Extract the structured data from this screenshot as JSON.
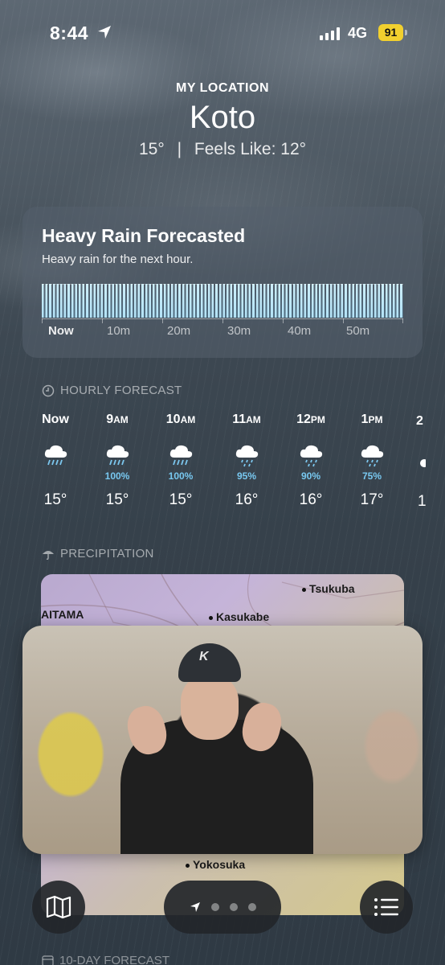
{
  "status_bar": {
    "time": "8:44",
    "network": "4G",
    "battery": "91",
    "battery_color": "#f2d02e"
  },
  "header": {
    "location_label": "MY LOCATION",
    "city": "Koto",
    "current_temp": "15°",
    "separator": "|",
    "feels_like": "Feels Like: 12°"
  },
  "rain_alert": {
    "title": "Heavy Rain Forecasted",
    "subtitle": "Heavy rain for the next hour.",
    "axis_labels": [
      "Now",
      "10m",
      "20m",
      "30m",
      "40m",
      "50m"
    ],
    "bar_color": "#cdeefa"
  },
  "hourly": {
    "header": "HOURLY FORECAST",
    "icon": "clock-icon",
    "items": [
      {
        "hour": "Now",
        "ampm": "",
        "icon": "rain-cloud-icon",
        "chance": "",
        "temp": "15°"
      },
      {
        "hour": "9",
        "ampm": "AM",
        "icon": "rain-cloud-icon",
        "chance": "100%",
        "temp": "15°"
      },
      {
        "hour": "10",
        "ampm": "AM",
        "icon": "rain-cloud-icon",
        "chance": "100%",
        "temp": "15°"
      },
      {
        "hour": "11",
        "ampm": "AM",
        "icon": "drizzle-cloud-icon",
        "chance": "95%",
        "temp": "16°"
      },
      {
        "hour": "12",
        "ampm": "PM",
        "icon": "drizzle-cloud-icon",
        "chance": "90%",
        "temp": "16°"
      },
      {
        "hour": "1",
        "ampm": "PM",
        "icon": "drizzle-cloud-icon",
        "chance": "75%",
        "temp": "17°"
      }
    ],
    "chance_color": "#78c8f0"
  },
  "precipitation": {
    "header": "PRECIPITATION",
    "icon": "umbrella-icon",
    "map_labels": {
      "tsukuba": "Tsukuba",
      "saitama": "AITAMA",
      "kasukabe": "Kasukabe",
      "yokosuka": "Yokosuka"
    }
  },
  "next_section": {
    "header": "10-DAY FORECAST",
    "icon": "calendar-icon"
  },
  "bottom_bar": {
    "map_button_icon": "map-icon",
    "list_button_icon": "list-icon",
    "pager_icons": [
      "location-arrow-icon",
      "page-dot",
      "page-dot",
      "page-dot"
    ]
  },
  "video_overlay": {
    "cap_logo": "K"
  }
}
